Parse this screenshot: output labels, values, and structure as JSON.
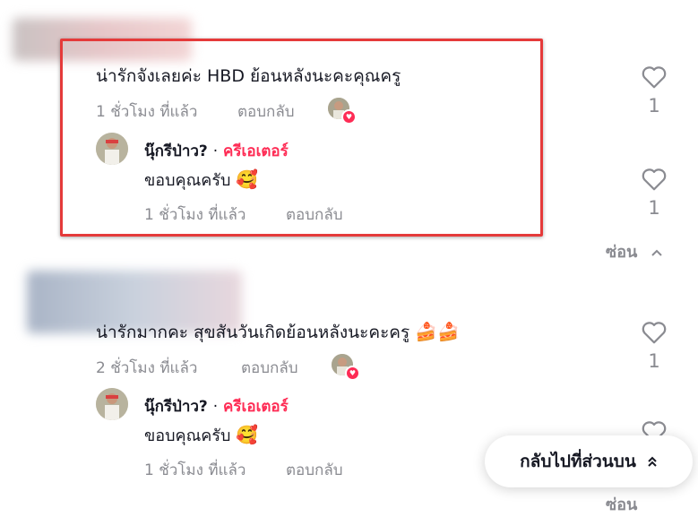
{
  "comments": [
    {
      "text": "น่ารักจังเลยค่ะ HBD ย้อนหลังนะคะคุณครู",
      "time": "1 ชั่วโมง ที่แล้ว",
      "reply_label": "ตอบกลับ",
      "likes": "1",
      "reply": {
        "author": "นุ๊กรีป่าว?",
        "separator": "·",
        "badge": "ครีเอเตอร์",
        "text": "ขอบคุณครับ",
        "emoji": "🥰",
        "time": "1 ชั่วโมง ที่แล้ว",
        "reply_label": "ตอบกลับ",
        "likes": "1"
      }
    },
    {
      "text": "น่ารักมากคะ สุขสันวันเกิดย้อนหลังนะคะครู",
      "emoji": "🍰🍰",
      "time": "2 ชั่วโมง ที่แล้ว",
      "reply_label": "ตอบกลับ",
      "likes": "1",
      "reply": {
        "author": "นุ๊กรีป่าว?",
        "separator": "·",
        "badge": "ครีเอเตอร์",
        "text": "ขอบคุณครับ",
        "emoji": "🥰",
        "time": "1 ชั่วโมง ที่แล้ว",
        "reply_label": "ตอบกลับ"
      }
    }
  ],
  "hide_label": "ซ่อน",
  "back_to_top_label": "กลับไปที่ส่วนบน",
  "colors": {
    "accent": "#fe2c55",
    "highlight_border": "#e53a3a",
    "muted": "#8a8b91"
  }
}
